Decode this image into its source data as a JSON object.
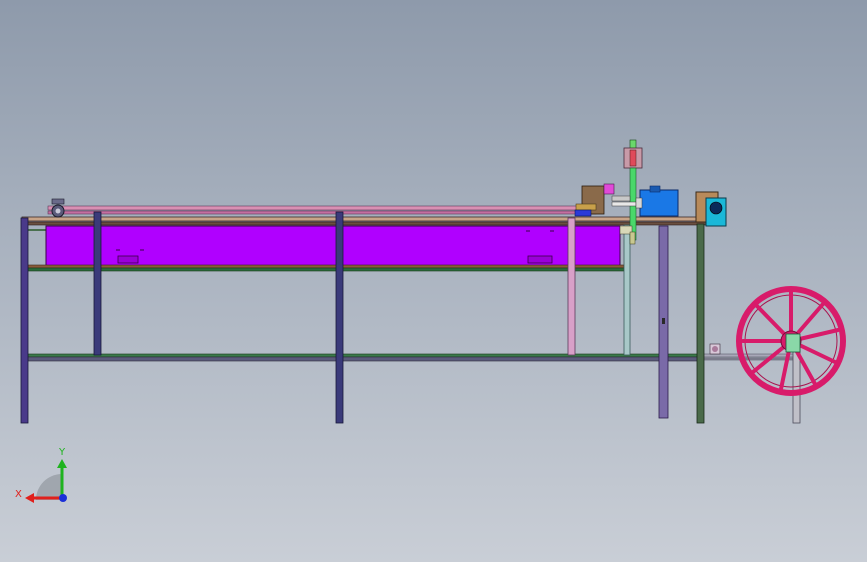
{
  "viewport": {
    "background_top": "#8e9aab",
    "background_bottom": "#c9ced6"
  },
  "triad": {
    "x_label": "X",
    "y_label": "Y",
    "x_color": "#e0201c",
    "y_color": "#1fb31f",
    "z_color": "#1a2fd8"
  },
  "model": {
    "frame_color": "#3a2a7a",
    "tank_color": "#b000ff",
    "wheel_color": "#d81b6a",
    "motor_color": "#1a78e6"
  }
}
